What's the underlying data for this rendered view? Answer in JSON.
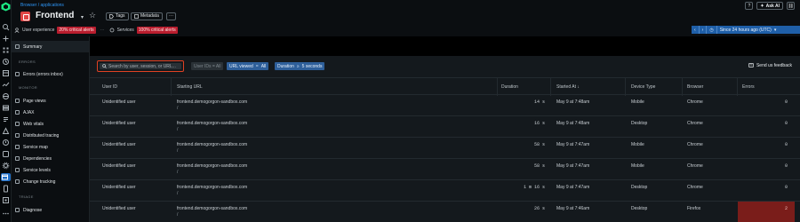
{
  "breadcrumb": "Browser / applications",
  "entity": {
    "title": "Frontend",
    "tags_label": "Tags",
    "metadata_label": "Metadata",
    "more_label": "···"
  },
  "status": {
    "ux_label": "User experience",
    "ux_alert": "20% critical alerts",
    "services_label": "Services",
    "services_alert": "100% critical alerts"
  },
  "header_right": {
    "help": "?",
    "ask_ai": "Ask AI",
    "link": "⛓"
  },
  "time_picker": {
    "label": "Since 24 hours ago (UTC)",
    "chevron": "▾"
  },
  "nav": {
    "summary": "Summary",
    "section_errors": "ERRORS",
    "errors_inbox": "Errors (errors inbox)",
    "section_monitor": "MONITOR",
    "items": [
      "Page views",
      "AJAX",
      "Web vitals",
      "Distributed tracing",
      "Service map",
      "Dependencies",
      "Service levels",
      "Change tracking"
    ],
    "section_triage": "TRIAGE",
    "diagnose": "Diagnose"
  },
  "filters": {
    "search_placeholder": "Search by user, session, or URL...",
    "user_ids": "User IDs = All",
    "url_viewed": "URL viewed",
    "url_viewed_value": "All",
    "duration": "Duration",
    "duration_op": "≥",
    "duration_value": "5 seconds",
    "feedback": "Send us feedback"
  },
  "table": {
    "columns": [
      "User ID",
      "Starting URL",
      "Duration",
      "Started At ↓",
      "Device Type",
      "Browser",
      "Errors"
    ],
    "rows": [
      {
        "user": "Unidentified user",
        "url": "frontend.demogorgon-sandbox.com",
        "path": "/",
        "duration": "14 s",
        "started": "May 9 at 7:48am",
        "device": "Mobile",
        "browser": "Chrome",
        "errors": "0"
      },
      {
        "user": "Unidentified user",
        "url": "frontend.demogorgon-sandbox.com",
        "path": "/",
        "duration": "16 s",
        "started": "May 9 at 7:48am",
        "device": "Desktop",
        "browser": "Chrome",
        "errors": "0"
      },
      {
        "user": "Unidentified user",
        "url": "frontend.demogorgon-sandbox.com",
        "path": "/",
        "duration": "58 s",
        "started": "May 9 at 7:47am",
        "device": "Mobile",
        "browser": "Chrome",
        "errors": "0"
      },
      {
        "user": "Unidentified user",
        "url": "frontend.demogorgon-sandbox.com",
        "path": "/",
        "duration": "58 s",
        "started": "May 9 at 7:47am",
        "device": "Mobile",
        "browser": "Chrome",
        "errors": "0"
      },
      {
        "user": "Unidentified user",
        "url": "frontend.demogorgon-sandbox.com",
        "path": "/",
        "duration": "1 m 16 s",
        "started": "May 9 at 7:47am",
        "device": "Desktop",
        "browser": "Chrome",
        "errors": "0"
      },
      {
        "user": "Unidentified user",
        "url": "frontend.demogorgon-sandbox.com",
        "path": "/",
        "duration": "26 s",
        "started": "May 9 at 7:46am",
        "device": "Desktop",
        "browser": "Firefox",
        "errors": "2"
      }
    ]
  },
  "colors": {
    "accent": "#1f6fc8",
    "alert": "#b91d2e",
    "search_border": "#e04123",
    "error_hot": "#7a1d1a"
  }
}
